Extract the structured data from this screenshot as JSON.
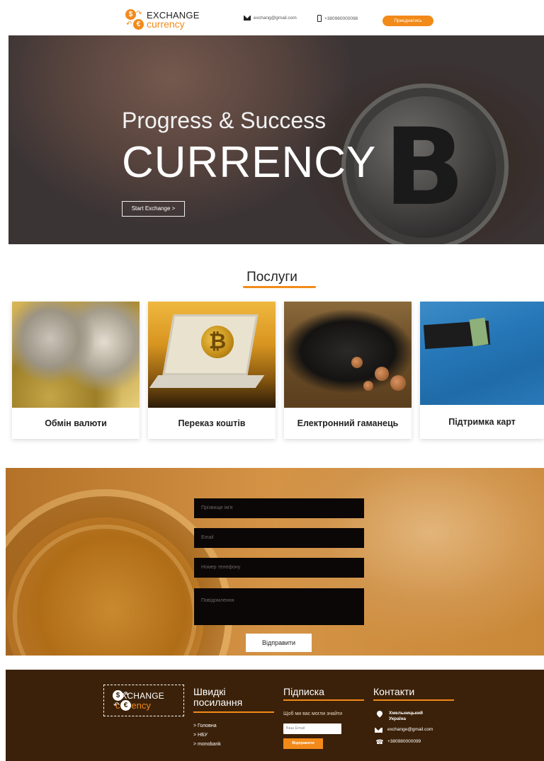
{
  "header": {
    "logo_line1": "EXCHANGE",
    "logo_line2": "currency",
    "email": "exchang@gmail.com",
    "phone": "+380980000098",
    "join_label": "Приєднатись",
    "accent_color": "#f28a1a"
  },
  "hero": {
    "subtitle": "Progress & Success",
    "title": "CURRENCY",
    "button_label": "Start Exchange >",
    "coin_glyph": "B"
  },
  "services": {
    "title": "Послуги",
    "items": [
      {
        "label": "Обмін валюти",
        "image": "euro-coins-gears"
      },
      {
        "label": "Переказ коштів",
        "image": "laptop-bitcoin"
      },
      {
        "label": "Електронний гаманець",
        "image": "wallet-coins"
      },
      {
        "label": "Підтримка карт",
        "image": "wallet-in-pocket"
      }
    ]
  },
  "form": {
    "name_placeholder": "Прізвище ім'я",
    "email_placeholder": "Email",
    "phone_placeholder": "Номер телефону",
    "message_placeholder": "Повідомлення",
    "submit_label": "Відправити"
  },
  "footer": {
    "logo_line1": "EXCHANGE",
    "logo_line2": "currency",
    "links_title": "Швидкі посилання",
    "links": [
      "> Головна",
      "> НБУ",
      "> monobank"
    ],
    "subscribe_title": "Підписка",
    "subscribe_text": "Щоб ми вас могли знайти",
    "subscribe_placeholder": "Ваш Email",
    "subscribe_button": "Відправити",
    "contacts_title": "Контакти",
    "address_line1": "Хмельницький",
    "address_line2": "Україна",
    "contact_email": "exchange@gmail.com",
    "contact_phone": "+380980000099"
  }
}
